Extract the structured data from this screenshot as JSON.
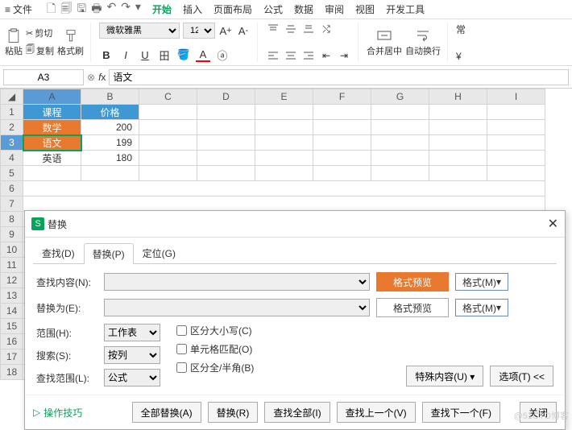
{
  "menubar": {
    "file": "文件",
    "tabs": [
      "开始",
      "插入",
      "页面布局",
      "公式",
      "数据",
      "审阅",
      "视图",
      "开发工具"
    ],
    "active": 0
  },
  "ribbon": {
    "paste": "粘贴",
    "cut": "剪切",
    "copy": "复制",
    "format_painter": "格式刷",
    "font_name": "微软雅黑",
    "font_size": "12",
    "merge": "合并居中",
    "wrap": "自动换行",
    "currency": "常",
    "yen": "¥"
  },
  "formula_bar": {
    "name_box": "A3",
    "fx_value": "语文"
  },
  "grid": {
    "cols": [
      "A",
      "B",
      "C",
      "D",
      "E",
      "F",
      "G",
      "H",
      "I"
    ],
    "rows": [
      {
        "r": 1,
        "A": "课程",
        "B": "价格"
      },
      {
        "r": 2,
        "A": "数学",
        "B": "200"
      },
      {
        "r": 3,
        "A": "语文",
        "B": "199"
      },
      {
        "r": 4,
        "A": "英语",
        "B": "180"
      }
    ],
    "selected": "A3"
  },
  "dialog": {
    "title": "替换",
    "tabs": {
      "find": "查找(D)",
      "replace": "替换(P)",
      "goto": "定位(G)"
    },
    "find_label": "查找内容(N):",
    "replace_label": "替换为(E):",
    "preview1": "格式预览",
    "preview2": "格式预览",
    "format_btn": "格式(M)",
    "scope_label": "范围(H):",
    "scope_value": "工作表",
    "search_label": "搜索(S):",
    "search_value": "按列",
    "lookin_label": "查找范围(L):",
    "lookin_value": "公式",
    "match_case": "区分大小写(C)",
    "match_cell": "单元格匹配(O)",
    "match_width": "区分全/半角(B)",
    "special": "特殊内容(U)",
    "options": "选项(T) <<",
    "tips": "操作技巧",
    "replace_all": "全部替换(A)",
    "replace_btn": "替换(R)",
    "find_all": "查找全部(I)",
    "find_prev": "查找上一个(V)",
    "find_next": "查找下一个(F)",
    "close": "关闭"
  },
  "watermark": "@51CTO博客"
}
